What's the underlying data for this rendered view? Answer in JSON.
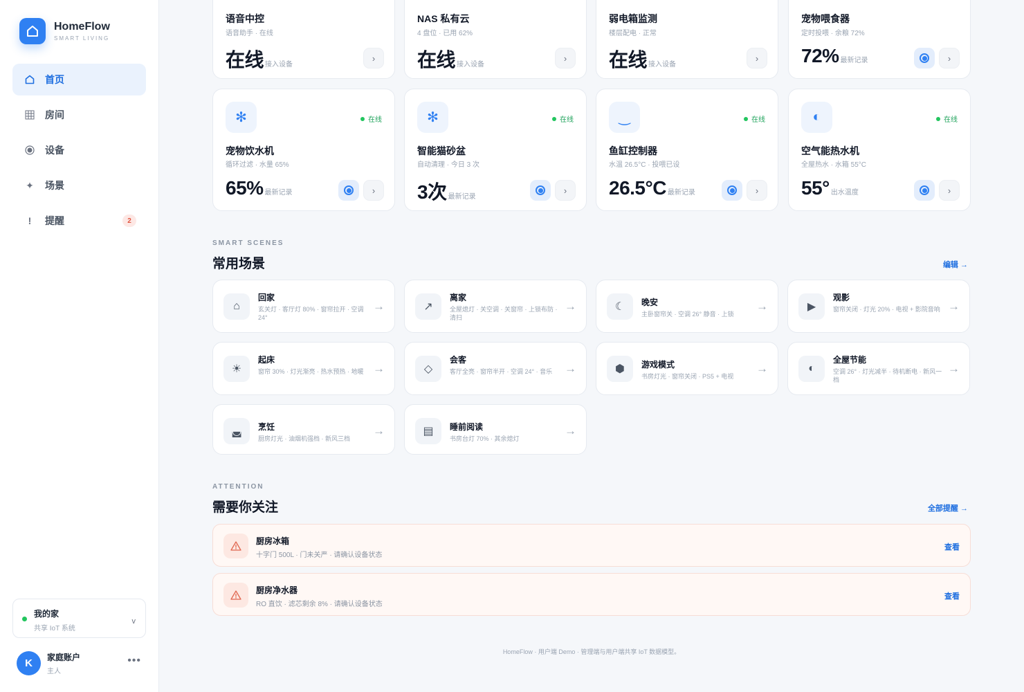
{
  "brand": {
    "title": "HomeFlow",
    "subtitle": "SMART LIVING"
  },
  "nav": [
    {
      "label": "首页",
      "icon": "home-icon",
      "active": true
    },
    {
      "label": "房间",
      "icon": "grid-icon"
    },
    {
      "label": "设备",
      "icon": "device-icon"
    },
    {
      "label": "场景",
      "icon": "sparkle-icon"
    },
    {
      "label": "提醒",
      "icon": "alert-icon",
      "badge": "2"
    }
  ],
  "home": {
    "name": "我的家",
    "sub": "共享 IoT 系统",
    "chevron": "v"
  },
  "account": {
    "initial": "K",
    "name": "家庭账户",
    "role": "主人",
    "more": "•••"
  },
  "devices_top": [
    {
      "name": "语音中控",
      "sub": "语音助手 · 在线",
      "value": "在线",
      "note": "接入设备",
      "toggle": false
    },
    {
      "name": "NAS 私有云",
      "sub": "4 盘位 · 已用 62%",
      "value": "在线",
      "note": "接入设备",
      "toggle": false
    },
    {
      "name": "弱电箱监测",
      "sub": "楼层配电 · 正常",
      "value": "在线",
      "note": "接入设备",
      "toggle": false
    },
    {
      "name": "宠物喂食器",
      "sub": "定时投喂 · 余粮 72%",
      "value": "72%",
      "note": "最新记录",
      "toggle": true
    }
  ],
  "devices": [
    {
      "name": "宠物饮水机",
      "sub": "循环过滤 · 水量 65%",
      "value": "65%",
      "note": "最新记录",
      "status": "在线",
      "icon": "snowflake-icon",
      "glyph": "✻"
    },
    {
      "name": "智能猫砂盆",
      "sub": "自动清理 · 今日 3 次",
      "value": "3次",
      "note": "最新记录",
      "status": "在线",
      "icon": "snowflake-icon",
      "glyph": "✻"
    },
    {
      "name": "鱼缸控制器",
      "sub": "水温 26.5°C · 投喂已设",
      "value": "26.5°C",
      "note": "最新记录",
      "status": "在线",
      "icon": "wave-icon",
      "glyph": "‿"
    },
    {
      "name": "空气能热水机",
      "sub": "全屋热水 · 水箱 55°C",
      "value": "55°",
      "note": "出水温度",
      "status": "在线",
      "icon": "half-circle-icon",
      "glyph": "◐"
    }
  ],
  "scenes_section": {
    "eyebrow": "SMART SCENES",
    "title": "常用场景",
    "link": "编辑 →"
  },
  "scenes": [
    {
      "name": "回家",
      "desc": "玄关灯 · 客厅灯 80% · 窗帘拉开 · 空调 24°",
      "icon": "home-outline-icon",
      "glyph": "⌂"
    },
    {
      "name": "离家",
      "desc": "全屋熄灯 · 关空调 · 关窗帘 · 上锁布防 · 清扫",
      "icon": "arrow-out-icon",
      "glyph": "↗"
    },
    {
      "name": "晚安",
      "desc": "主卧窗帘关 · 空调 26° 静音 · 上锁",
      "icon": "moon-icon",
      "glyph": "☾"
    },
    {
      "name": "观影",
      "desc": "窗帘关闭 · 灯光 20% · 电视 + 影院音响",
      "icon": "play-icon",
      "glyph": "▶"
    },
    {
      "name": "起床",
      "desc": "窗帘 30% · 灯光渐亮 · 热水预热 · 地暖",
      "icon": "sun-icon",
      "glyph": "☀"
    },
    {
      "name": "会客",
      "desc": "客厅全亮 · 窗帘半开 · 空调 24° · 音乐",
      "icon": "diamond-icon",
      "glyph": "◇"
    },
    {
      "name": "游戏模式",
      "desc": "书房灯光 · 窗帘关闭 · PS5 + 电视",
      "icon": "hexagon-icon",
      "glyph": "⬢"
    },
    {
      "name": "全屋节能",
      "desc": "空调 26° · 灯光减半 · 待机断电 · 新风一档",
      "icon": "half-circle-icon",
      "glyph": "◐"
    },
    {
      "name": "烹饪",
      "desc": "厨房灯光 · 油烟机强档 · 新风三档",
      "icon": "cooking-icon",
      "glyph": "◛"
    },
    {
      "name": "睡前阅读",
      "desc": "书房台灯 70% · 其余熄灯",
      "icon": "book-icon",
      "glyph": "▤"
    }
  ],
  "attention_section": {
    "eyebrow": "ATTENTION",
    "title": "需要你关注",
    "link": "全部提醒 →"
  },
  "alerts": [
    {
      "name": "厨房冰箱",
      "desc": "十字门 500L · 门未关严 · 请确认设备状态",
      "link": "查看"
    },
    {
      "name": "厨房净水器",
      "desc": "RO 直饮 · 滤芯剩余 8% · 请确认设备状态",
      "link": "查看"
    }
  ],
  "footer": "HomeFlow · 用户端 Demo · 管理端与用户端共享 IoT 数据模型。"
}
